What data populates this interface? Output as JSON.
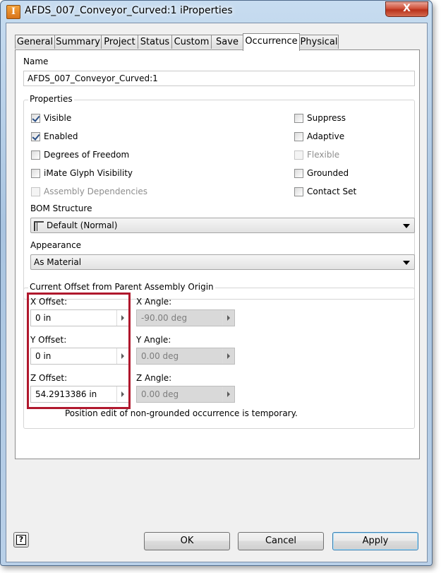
{
  "window": {
    "title": "AFDS_007_Conveyor_Curved:1 iProperties",
    "app_icon_letter": "I",
    "close_glyph": "X"
  },
  "tabs": [
    {
      "label": "General"
    },
    {
      "label": "Summary"
    },
    {
      "label": "Project"
    },
    {
      "label": "Status"
    },
    {
      "label": "Custom"
    },
    {
      "label": "Save"
    },
    {
      "label": "Occurrence",
      "active": true
    },
    {
      "label": "Physical"
    }
  ],
  "name": {
    "label": "Name",
    "value": "AFDS_007_Conveyor_Curved:1"
  },
  "properties": {
    "title": "Properties",
    "left": [
      {
        "label": "Visible",
        "checked": true,
        "enabled": true
      },
      {
        "label": "Enabled",
        "checked": true,
        "enabled": true
      },
      {
        "label": "Degrees of Freedom",
        "checked": false,
        "enabled": true
      },
      {
        "label": "iMate Glyph Visibility",
        "checked": false,
        "enabled": true
      },
      {
        "label": "Assembly Dependencies",
        "checked": false,
        "enabled": false
      }
    ],
    "right": [
      {
        "label": "Suppress",
        "checked": false,
        "enabled": true
      },
      {
        "label": "Adaptive",
        "checked": false,
        "enabled": true
      },
      {
        "label": "Flexible",
        "checked": false,
        "enabled": false
      },
      {
        "label": "Grounded",
        "checked": false,
        "enabled": true
      },
      {
        "label": "Contact Set",
        "checked": false,
        "enabled": true
      }
    ],
    "bom_label": "BOM Structure",
    "bom_value": "Default (Normal)",
    "appearance_label": "Appearance",
    "appearance_value": "As Material"
  },
  "offset": {
    "title": "Current Offset from Parent Assembly Origin",
    "x_label": "X Offset:",
    "x_value": "0 in",
    "y_label": "Y Offset:",
    "y_value": "0 in",
    "z_label": "Z Offset:",
    "z_value": "54.2913386 in",
    "xa_label": "X Angle:",
    "xa_value": "-90.00 deg",
    "ya_label": "Y Angle:",
    "ya_value": "0.00 deg",
    "za_label": "Z Angle:",
    "za_value": "0.00 deg",
    "note": "Position edit of non-grounded occurrence is temporary.",
    "highlight_color": "#b0182d"
  },
  "buttons": {
    "help_glyph": "?",
    "ok": "OK",
    "cancel": "Cancel",
    "apply": "Apply"
  }
}
